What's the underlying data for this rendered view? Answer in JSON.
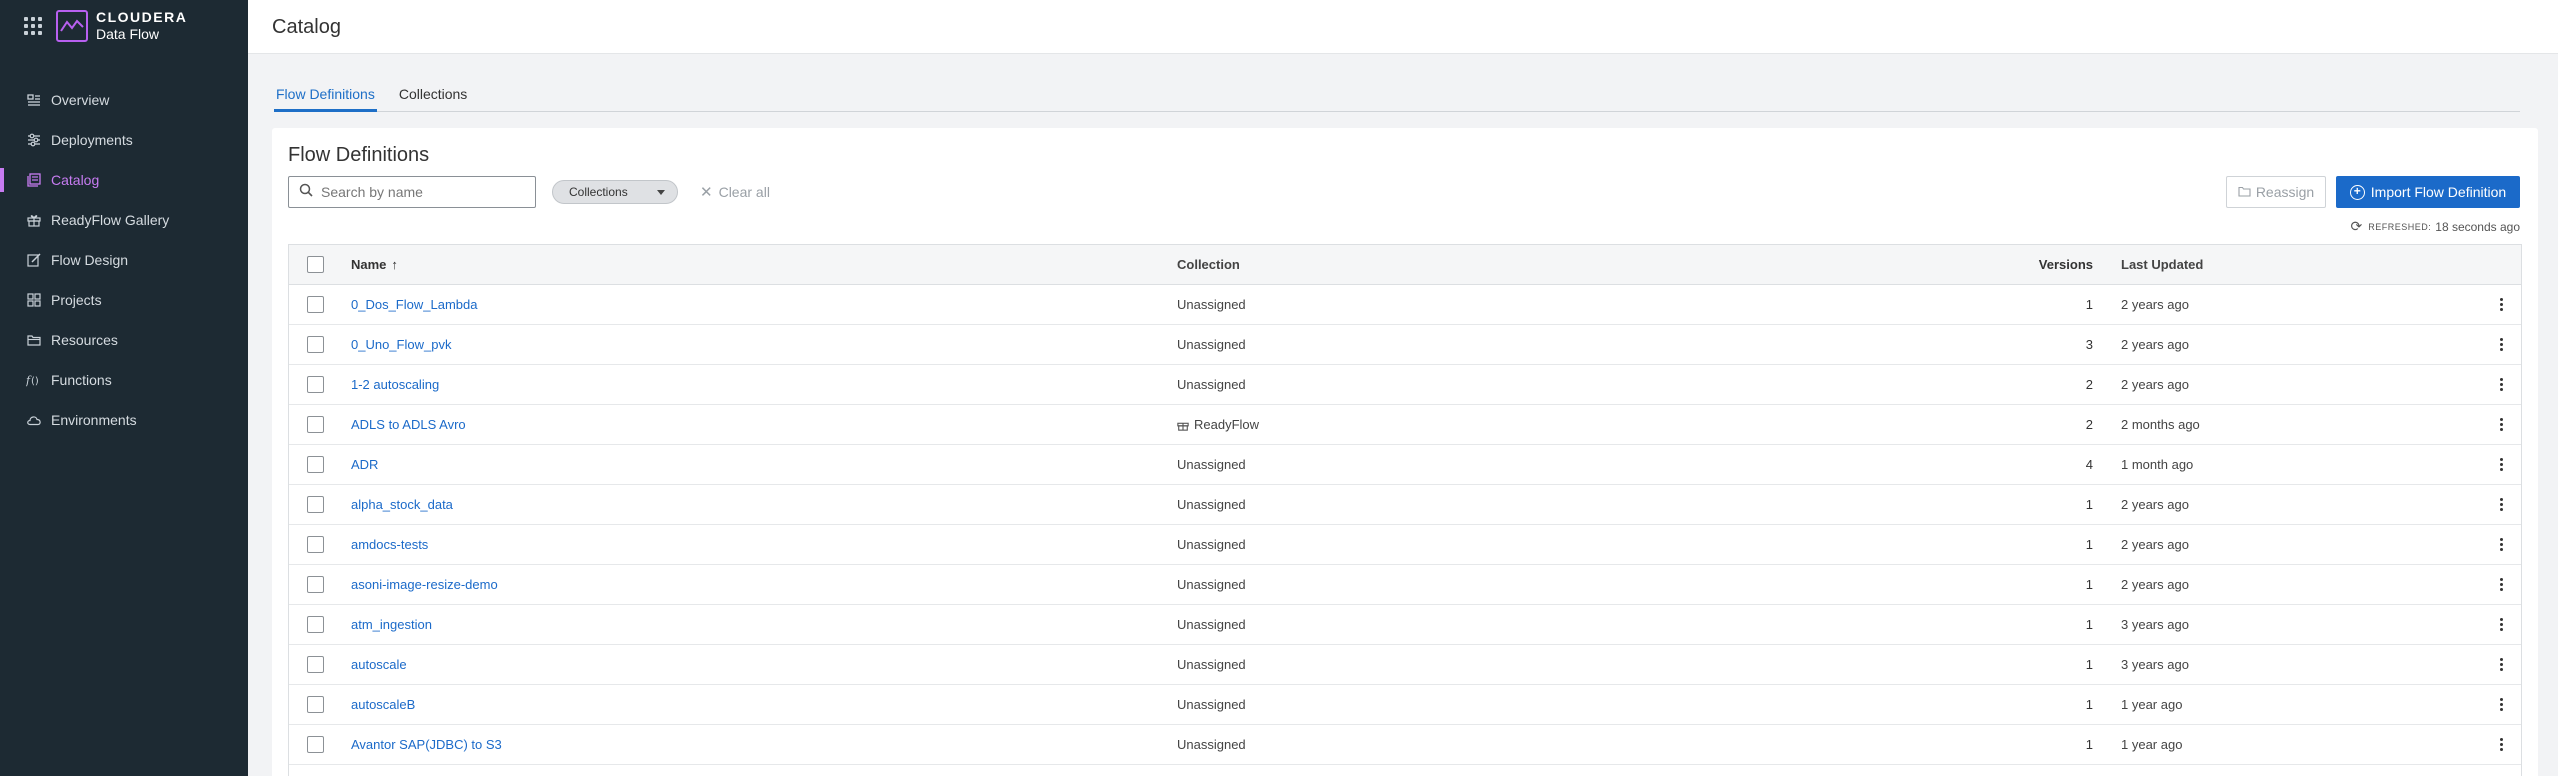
{
  "app": {
    "brand_name": "CLOUDERA",
    "product_name": "Data Flow"
  },
  "sidebar": {
    "items": [
      {
        "label": "Overview",
        "icon": "overview-icon",
        "active": false
      },
      {
        "label": "Deployments",
        "icon": "deployments-icon",
        "active": false
      },
      {
        "label": "Catalog",
        "icon": "catalog-icon",
        "active": true
      },
      {
        "label": "ReadyFlow Gallery",
        "icon": "gift-icon",
        "active": false
      },
      {
        "label": "Flow Design",
        "icon": "edit-icon",
        "active": false
      },
      {
        "label": "Projects",
        "icon": "projects-icon",
        "active": false
      },
      {
        "label": "Resources",
        "icon": "folder-icon",
        "active": false
      },
      {
        "label": "Functions",
        "icon": "function-icon",
        "active": false
      },
      {
        "label": "Environments",
        "icon": "cloud-icon",
        "active": false
      }
    ]
  },
  "header": {
    "title": "Catalog"
  },
  "tabs": [
    {
      "label": "Flow Definitions",
      "active": true
    },
    {
      "label": "Collections",
      "active": false
    }
  ],
  "main": {
    "title": "Flow Definitions",
    "search_placeholder": "Search by name",
    "collections_filter": "Collections",
    "clear_all": "Clear all",
    "reassign_label": "Reassign",
    "import_label": "Import Flow Definition",
    "refreshed_label": "REFRESHED:",
    "refreshed_value": "18 seconds ago"
  },
  "table": {
    "columns": {
      "name": "Name",
      "collection": "Collection",
      "versions": "Versions",
      "last_updated": "Last Updated"
    },
    "rows": [
      {
        "name": "0_Dos_Flow_Lambda",
        "collection": "Unassigned",
        "versions": "1",
        "last_updated": "2 years ago"
      },
      {
        "name": "0_Uno_Flow_pvk",
        "collection": "Unassigned",
        "versions": "3",
        "last_updated": "2 years ago"
      },
      {
        "name": "1-2 autoscaling",
        "collection": "Unassigned",
        "versions": "2",
        "last_updated": "2 years ago"
      },
      {
        "name": "ADLS to ADLS Avro",
        "collection": "ReadyFlow",
        "versions": "2",
        "last_updated": "2 months ago"
      },
      {
        "name": "ADR",
        "collection": "Unassigned",
        "versions": "4",
        "last_updated": "1 month ago"
      },
      {
        "name": "alpha_stock_data",
        "collection": "Unassigned",
        "versions": "1",
        "last_updated": "2 years ago"
      },
      {
        "name": "amdocs-tests",
        "collection": "Unassigned",
        "versions": "1",
        "last_updated": "2 years ago"
      },
      {
        "name": "asoni-image-resize-demo",
        "collection": "Unassigned",
        "versions": "1",
        "last_updated": "2 years ago"
      },
      {
        "name": "atm_ingestion",
        "collection": "Unassigned",
        "versions": "1",
        "last_updated": "3 years ago"
      },
      {
        "name": "autoscale",
        "collection": "Unassigned",
        "versions": "1",
        "last_updated": "3 years ago"
      },
      {
        "name": "autoscaleB",
        "collection": "Unassigned",
        "versions": "1",
        "last_updated": "1 year ago"
      },
      {
        "name": "Avantor SAP(JDBC) to S3",
        "collection": "Unassigned",
        "versions": "1",
        "last_updated": "1 year ago"
      },
      {
        "name": "",
        "collection": "",
        "versions": "",
        "last_updated": ""
      }
    ]
  },
  "colors": {
    "sidebar_bg": "#1d2a33",
    "accent_purple": "#c77cf2",
    "link_blue": "#1b6ac9"
  }
}
